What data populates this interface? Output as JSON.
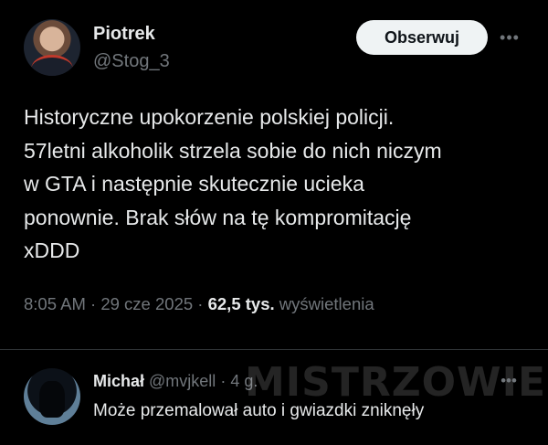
{
  "tweet": {
    "author_name": "Piotrek",
    "author_handle": "@Stog_3",
    "follow_label": "Obserwuj",
    "more_label": "•••",
    "text_lines": [
      "Historyczne upokorzenie polskiej policji.",
      "57letni alkoholik strzela sobie do nich niczym",
      "w GTA i następnie skutecznie ucieka",
      "ponownie. Brak słów na tę kompromitację",
      "xDDD"
    ],
    "time": "8:05 AM",
    "separator": "·",
    "date": "29 cze 2025",
    "views_count": "62,5 tys.",
    "views_label": "wyświetlenia"
  },
  "reply": {
    "author_name": "Michał",
    "author_handle": "@mvjkell",
    "age": "4 g.",
    "separator": "·",
    "more_label": "•••",
    "text": "Może przemalował auto i gwiazdki zniknęły"
  },
  "watermark": "MISTRZOWIE",
  "colors": {
    "background": "#000000",
    "text": "#e7e9ea",
    "muted": "#71767b",
    "button_bg": "#eff3f4",
    "divider": "#2f3336"
  }
}
